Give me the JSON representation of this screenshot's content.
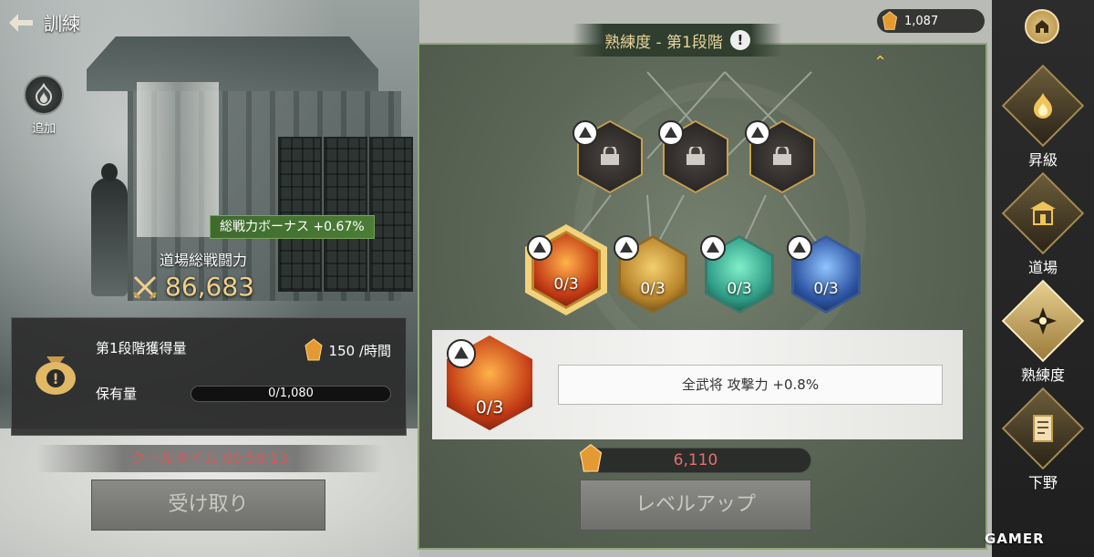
{
  "header": {
    "title": "訓練",
    "back_icon": "back-arrow-icon"
  },
  "left": {
    "add_label": "追加",
    "bonus_badge": "総戦力ボーナス +0.67%",
    "power_label": "道場総戦闘力",
    "power_value": "86,683",
    "yield_label": "第1段階獲得量",
    "yield_rate": "150 /時間",
    "hold_label": "保有量",
    "hold_value": "0/1,080",
    "hold_fraction": 0.0,
    "cooltime": "クールタイム 00:58:13",
    "receive_button": "受け取り"
  },
  "currency": {
    "value": "1,087",
    "icon": "amber-crystal-icon"
  },
  "tree": {
    "stage_title": "熟練度 - 第1段階",
    "info_icon": "!",
    "locked_nodes": [
      "lock-node-1",
      "lock-node-2",
      "lock-node-3"
    ],
    "skills": [
      {
        "name": "attack",
        "level": "0/3",
        "color": "#c8471c"
      },
      {
        "name": "strength",
        "level": "0/3",
        "color": "#d7a63a"
      },
      {
        "name": "heart",
        "level": "0/3",
        "color": "#2f9c86"
      },
      {
        "name": "shield",
        "level": "0/3",
        "color": "#2e55a3"
      }
    ]
  },
  "detail": {
    "level": "0/3",
    "effect": "全武将 攻撃力 +0.8%"
  },
  "cost": {
    "value": "6,110"
  },
  "levelup_button": "レベルアップ",
  "nav": {
    "home_icon": "home-icon",
    "items": [
      {
        "label": "昇級",
        "icon": "flame-icon"
      },
      {
        "label": "道場",
        "icon": "dojo-icon"
      },
      {
        "label": "熟練度",
        "icon": "emblem-icon"
      },
      {
        "label": "下野",
        "icon": "scroll-icon"
      }
    ]
  },
  "watermark": "GAMER",
  "colors": {
    "accent_gold": "#e9d39c",
    "cooltime_red": "#d25b5b",
    "cost_red": "#e07070",
    "bonus_green": "#4b7d35"
  }
}
